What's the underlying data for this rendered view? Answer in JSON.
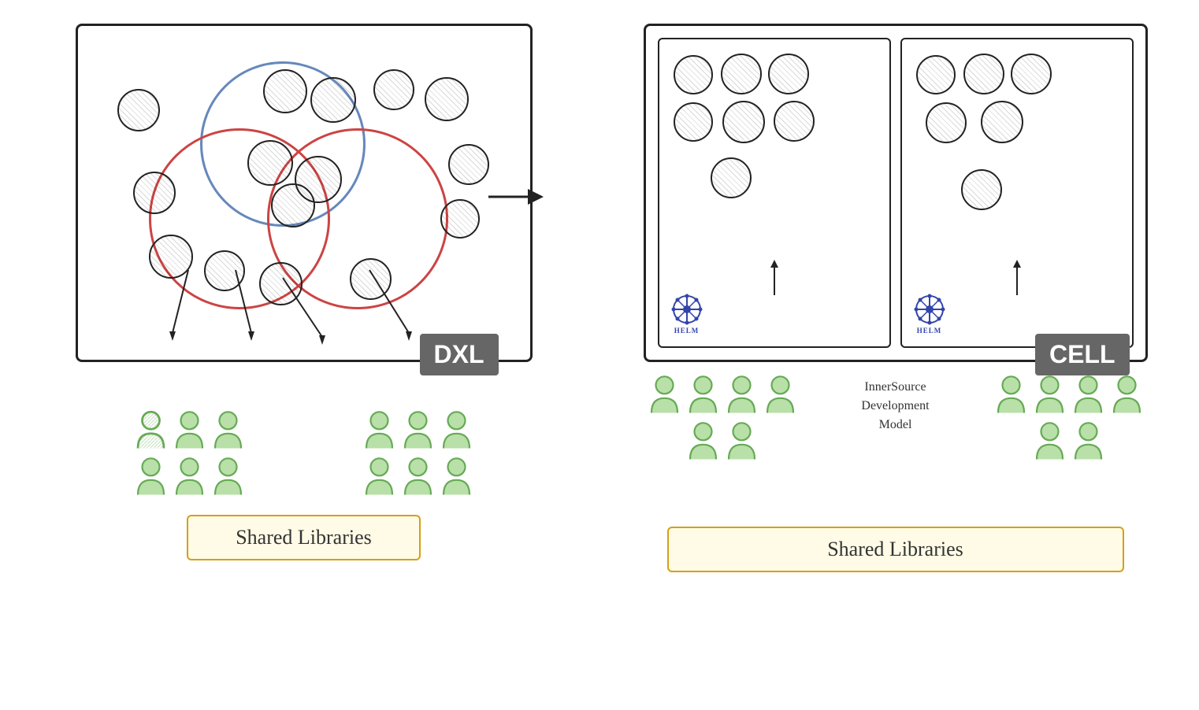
{
  "left": {
    "dxl_label": "DXL",
    "shared_libraries_label": "Shared Libraries"
  },
  "right": {
    "cell_label": "CELL",
    "shared_libraries_label": "Shared Libraries",
    "innersource_text": "InnerSource\nDevelopment\nModel",
    "helm_label": "HELM"
  }
}
